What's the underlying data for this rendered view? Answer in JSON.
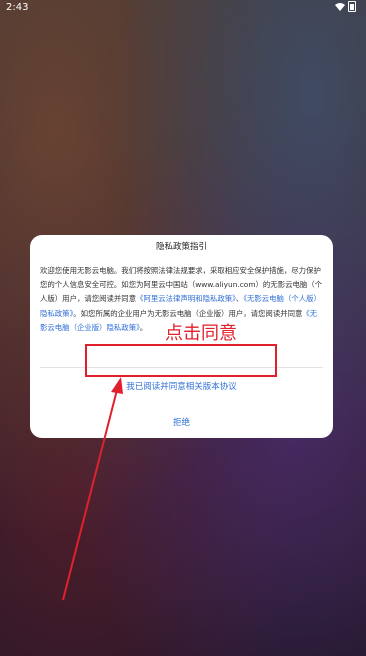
{
  "status_bar": {
    "time": "2:43"
  },
  "dialog": {
    "title": "隐私政策指引",
    "body_part1": "欢迎您使用无影云电脑。我们将按照法律法规要求，采取相应安全保护措施，尽力保护您的个人信息安全可控。如您为阿里云中国站（www.aliyun.com）的无影云电脑（个人版）用户，请您阅读并同意",
    "link1": "《阿里云法律声明和隐私政策》",
    "body_part2": "、",
    "link2": "《无影云电脑（个人版）隐私政策》",
    "body_part3": "。如您所属的企业用户为无影云电脑（企业版）用户，请您阅读并同意",
    "link3": "《无影云电脑（企业版）隐私政策》",
    "body_part4": "。",
    "agree_label": "我已阅读并同意相关版本协议",
    "reject_label": "拒绝"
  },
  "annotation": {
    "text": "点击同意",
    "color": "#e0212d"
  },
  "colors": {
    "link": "#2f6fd6",
    "highlight": "#e0212d"
  }
}
